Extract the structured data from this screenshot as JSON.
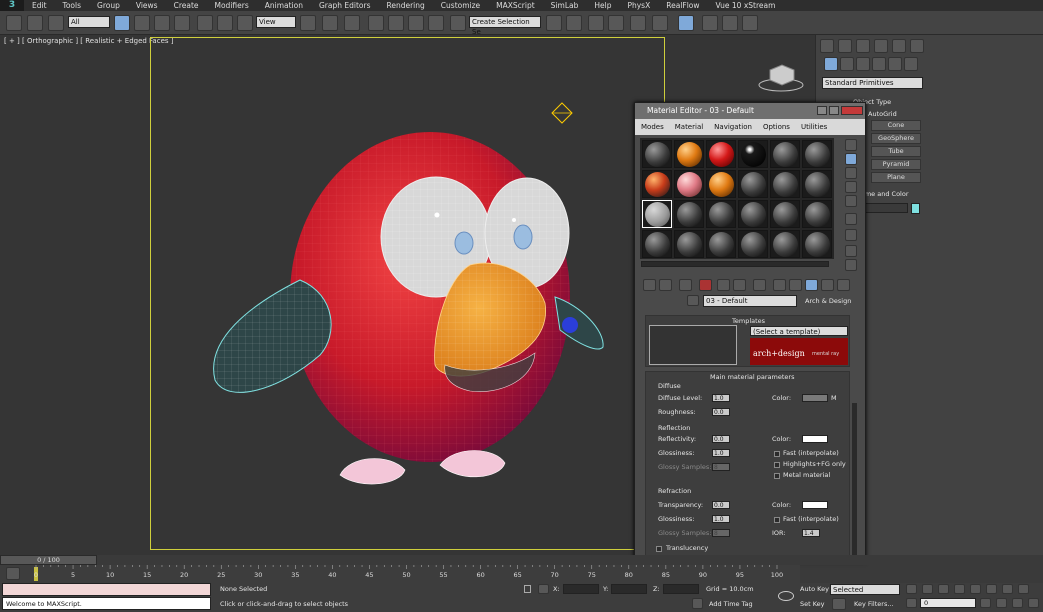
{
  "app": {
    "logo": "3"
  },
  "menubar": [
    "Edit",
    "Tools",
    "Group",
    "Views",
    "Create",
    "Modifiers",
    "Animation",
    "Graph Editors",
    "Rendering",
    "Customize",
    "MAXScript",
    "SimLab",
    "Help",
    "PhysX",
    "RealFlow",
    "Vue 10 xStream"
  ],
  "toolbar": {
    "filter": "All",
    "ref_coord": "View",
    "named_sel": "Create Selection Se"
  },
  "viewport": {
    "label": "[ + ] [ Orthographic ] [ Realistic + Edged Faces ]"
  },
  "command_panel": {
    "category": "Standard Primitives",
    "rollout_object_type": "Object Type",
    "grid_label": "AutoGrid",
    "buttons": [
      "Cone",
      "GeoSphere",
      "Tube",
      "Pyramid",
      "Plane"
    ],
    "rollout_name_color": "Name and Color",
    "object_color": "#7ee0e0"
  },
  "material_editor": {
    "title": "Material Editor - 03 - Default",
    "menu": [
      "Modes",
      "Material",
      "Navigation",
      "Options",
      "Utilities"
    ],
    "slots": [
      {
        "type": "grey"
      },
      {
        "type": "orange"
      },
      {
        "type": "red"
      },
      {
        "type": "black"
      },
      {
        "type": "grey"
      },
      {
        "type": "grey"
      },
      {
        "type": "mixed"
      },
      {
        "type": "pink"
      },
      {
        "type": "orange"
      },
      {
        "type": "grey"
      },
      {
        "type": "grey"
      },
      {
        "type": "grey"
      },
      {
        "type": "selected"
      },
      {
        "type": "grey"
      },
      {
        "type": "grey"
      },
      {
        "type": "grey"
      },
      {
        "type": "grey"
      },
      {
        "type": "grey"
      },
      {
        "type": "grey"
      },
      {
        "type": "grey"
      },
      {
        "type": "grey"
      },
      {
        "type": "grey"
      },
      {
        "type": "grey"
      },
      {
        "type": "grey"
      }
    ],
    "material_name": "03 - Default",
    "material_type": "Arch & Design",
    "templates": {
      "title": "Templates",
      "select": "(Select a template)",
      "logo_main": "arch+design",
      "logo_sub": "mental ray"
    },
    "main_params": {
      "title": "Main material parameters",
      "diffuse": {
        "title": "Diffuse",
        "level_label": "Diffuse Level:",
        "level": "1.0",
        "roughness_label": "Roughness:",
        "roughness": "0.0",
        "color_label": "Color:",
        "map_flag": "M"
      },
      "reflection": {
        "title": "Reflection",
        "reflectivity_label": "Reflectivity:",
        "reflectivity": "0.0",
        "glossiness_label": "Glossiness:",
        "glossiness": "1.0",
        "samples_label": "Glossy Samples:",
        "samples": "8",
        "color_label": "Color:",
        "fast": "Fast (interpolate)",
        "highlights": "Highlights+FG only",
        "metal": "Metal material"
      },
      "refraction": {
        "title": "Refraction",
        "transparency_label": "Transparency:",
        "transparency": "0.0",
        "glossiness_label": "Glossiness:",
        "glossiness": "1.0",
        "samples_label": "Glossy Samples:",
        "samples": "8",
        "color_label": "Color:",
        "fast": "Fast (interpolate)",
        "ior_label": "IOR:",
        "ior": "1.4"
      },
      "translucency": "Translucency"
    }
  },
  "timeline": {
    "frame_counter": "0 / 100",
    "ticks": [
      "0",
      "5",
      "10",
      "15",
      "20",
      "25",
      "30",
      "35",
      "40",
      "45",
      "50",
      "55",
      "60",
      "65",
      "70",
      "75",
      "80",
      "85",
      "90",
      "95",
      "100"
    ]
  },
  "status": {
    "maxscript": "Welcome to MAXScript.",
    "selection": "None Selected",
    "prompt": "Click or click-and-drag to select objects",
    "x_label": "X:",
    "y_label": "Y:",
    "z_label": "Z:",
    "grid": "Grid = 10.0cm",
    "add_time_tag": "Add Time Tag",
    "auto_key": "Auto Key",
    "set_key": "Set Key",
    "key_mode": "Selected",
    "key_filters": "Key Filters...",
    "frame": "0"
  }
}
